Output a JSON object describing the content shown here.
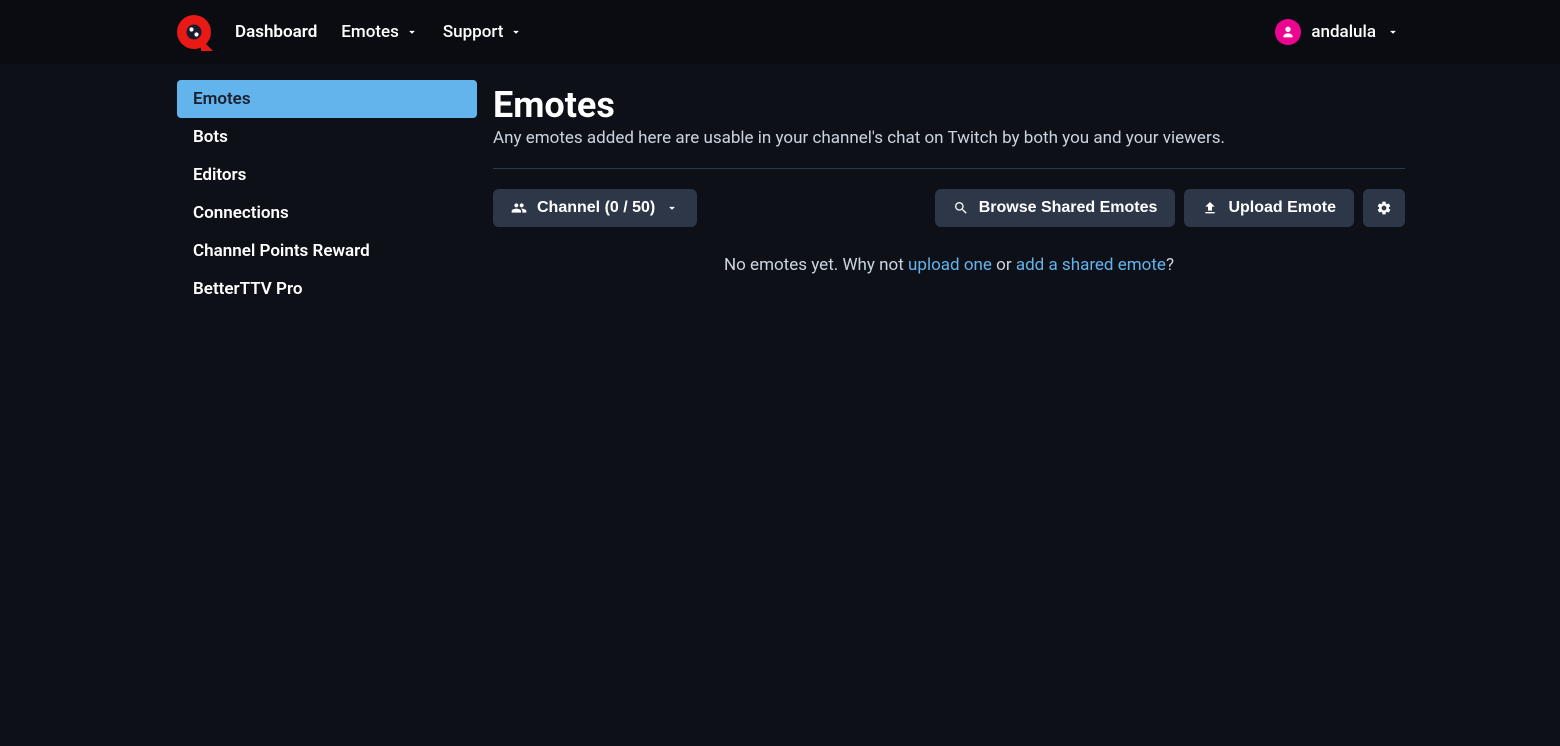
{
  "header": {
    "nav": {
      "dashboard": "Dashboard",
      "emotes": "Emotes",
      "support": "Support"
    },
    "user": {
      "username": "andalula"
    }
  },
  "sidebar": {
    "items": [
      {
        "label": "Emotes",
        "active": true
      },
      {
        "label": "Bots",
        "active": false
      },
      {
        "label": "Editors",
        "active": false
      },
      {
        "label": "Connections",
        "active": false
      },
      {
        "label": "Channel Points Reward",
        "active": false
      },
      {
        "label": "BetterTTV Pro",
        "active": false
      }
    ]
  },
  "page": {
    "title": "Emotes",
    "subtitle": "Any emotes added here are usable in your channel's chat on Twitch by both you and your viewers."
  },
  "actions": {
    "channel_label": "Channel (0 / 50)",
    "browse_label": "Browse Shared Emotes",
    "upload_label": "Upload Emote"
  },
  "empty": {
    "prefix": "No emotes yet. Why not ",
    "link1": "upload one",
    "middle": " or ",
    "link2": "add a shared emote",
    "suffix": "?"
  }
}
